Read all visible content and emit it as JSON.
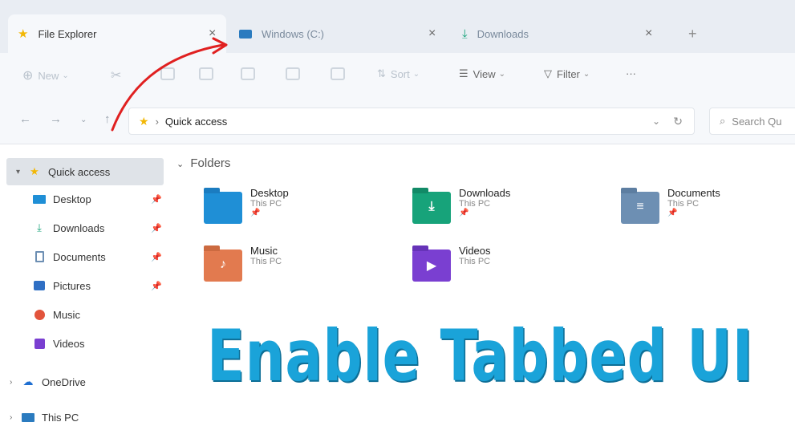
{
  "tabs": [
    {
      "label": "File Explorer",
      "icon": "star-icon",
      "active": true
    },
    {
      "label": "Windows (C:)",
      "icon": "drive-icon",
      "active": false
    },
    {
      "label": "Downloads",
      "icon": "download-icon",
      "active": false
    }
  ],
  "tab_close_glyph": "×",
  "tab_add_glyph": "+",
  "commandbar": {
    "new_label": "New",
    "sort_label": "Sort",
    "view_label": "View",
    "filter_label": "Filter",
    "more_label": "···"
  },
  "address": {
    "location": "Quick access",
    "search_placeholder": "Search Qu"
  },
  "sidebar": {
    "items": [
      {
        "label": "Quick access",
        "icon": "star-icon"
      },
      {
        "label": "Desktop",
        "icon": "desktop-icon",
        "pinned": true
      },
      {
        "label": "Downloads",
        "icon": "download-icon",
        "pinned": true
      },
      {
        "label": "Documents",
        "icon": "document-icon",
        "pinned": true
      },
      {
        "label": "Pictures",
        "icon": "pictures-icon",
        "pinned": true
      },
      {
        "label": "Music",
        "icon": "music-icon"
      },
      {
        "label": "Videos",
        "icon": "videos-icon"
      },
      {
        "label": "OneDrive",
        "icon": "cloud-icon"
      },
      {
        "label": "This PC",
        "icon": "pc-icon"
      }
    ]
  },
  "main": {
    "section_title": "Folders",
    "folders": [
      {
        "name": "Desktop",
        "location": "This PC",
        "pinned": true,
        "color": "#1f8fd6"
      },
      {
        "name": "Downloads",
        "location": "This PC",
        "pinned": true,
        "color": "#17a37a"
      },
      {
        "name": "Documents",
        "location": "This PC",
        "pinned": true,
        "color": "#6d8fb3"
      },
      {
        "name": "Music",
        "location": "This PC",
        "pinned": false,
        "color": "#e27a4f"
      },
      {
        "name": "Videos",
        "location": "This PC",
        "pinned": false,
        "color": "#7a3fd1"
      }
    ]
  },
  "banner": {
    "text": "Enable Tabbed UI",
    "color": "#1aa3d9"
  },
  "colors": {
    "arrow": "#e02020",
    "tab_active_bg": "#f6f8fb",
    "tabstrip_bg": "#e9edf3"
  }
}
